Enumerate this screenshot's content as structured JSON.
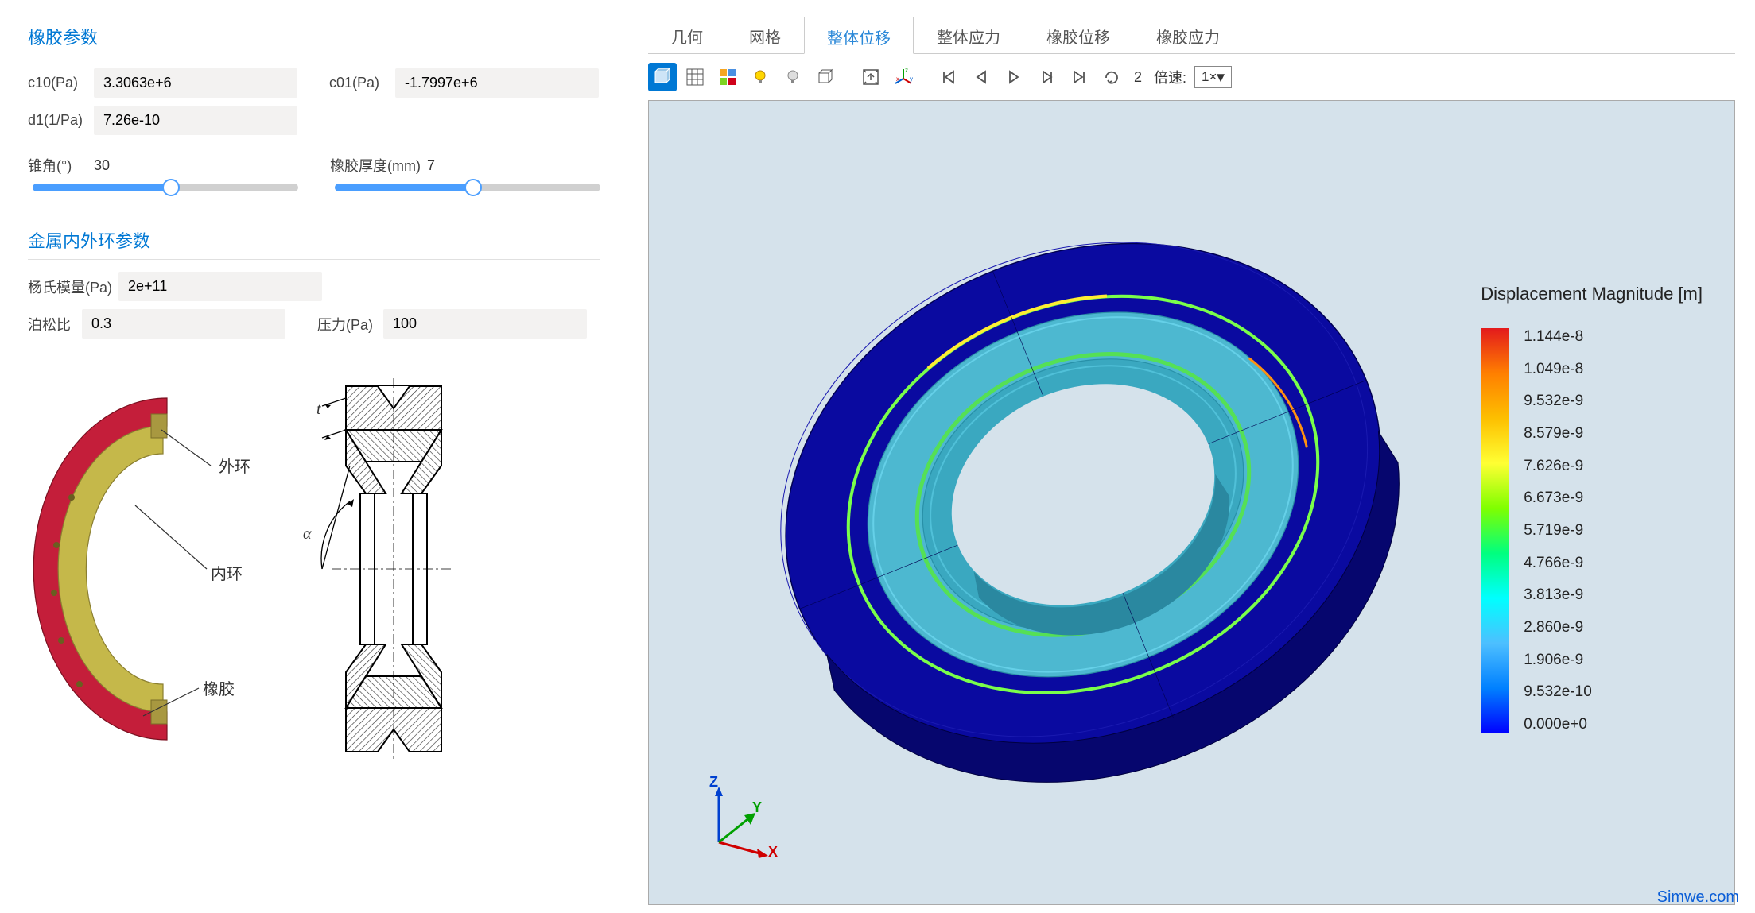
{
  "rubber": {
    "title": "橡胶参数",
    "c10_label": "c10(Pa)",
    "c10_value": "3.3063e+6",
    "c01_label": "c01(Pa)",
    "c01_value": "-1.7997e+6",
    "d1_label": "d1(1/Pa)",
    "d1_value": "7.26e-10",
    "cone_label": "锥角(°)",
    "cone_value": "30",
    "thick_label": "橡胶厚度(mm)",
    "thick_value": "7"
  },
  "metal": {
    "title": "金属内外环参数",
    "young_label": "杨氏模量(Pa)",
    "young_value": "2e+11",
    "poisson_label": "泊松比",
    "poisson_value": "0.3",
    "pressure_label": "压力(Pa)",
    "pressure_value": "100"
  },
  "diagram": {
    "outer_ring": "外环",
    "inner_ring": "内环",
    "rubber": "橡胶",
    "alpha": "α",
    "t": "t"
  },
  "tabs": [
    "几何",
    "网格",
    "整体位移",
    "整体应力",
    "橡胶位移",
    "橡胶应力"
  ],
  "active_tab": 2,
  "toolbar": {
    "frame": "2",
    "speed_label": "倍速:",
    "speed_value": "1×"
  },
  "axes": {
    "x": "X",
    "y": "Y",
    "z": "Z"
  },
  "legend": {
    "title": "Displacement Magnitude [m]",
    "ticks": [
      "1.144e-8",
      "1.049e-8",
      "9.532e-9",
      "8.579e-9",
      "7.626e-9",
      "6.673e-9",
      "5.719e-9",
      "4.766e-9",
      "3.813e-9",
      "2.860e-9",
      "1.906e-9",
      "9.532e-10",
      "0.000e+0"
    ]
  },
  "watermark": "Simwe.com"
}
